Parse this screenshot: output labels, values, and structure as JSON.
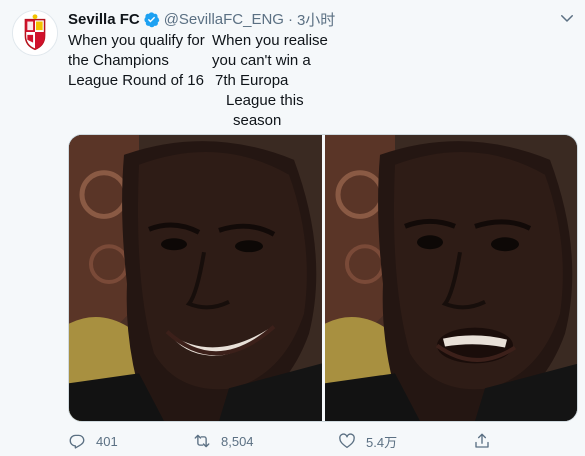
{
  "tweet": {
    "name": "Sevilla FC",
    "handle": "@SevillaFC_ENG",
    "separator": "·",
    "time": "3小时",
    "caption_left": "When you qualify for the Champions League Round of 16",
    "caption_right_lines": [
      "When you realise",
      "you can't win a",
      "7th Europa",
      "  League this",
      "   season"
    ]
  },
  "actions": {
    "reply_count": "401",
    "retweet_count": "8,504",
    "like_count": "5.4万"
  },
  "icons": {
    "avatar": "sevilla-crest",
    "verified": "verified-badge-icon",
    "more": "chevron-down-icon",
    "reply": "reply-icon",
    "retweet": "retweet-icon",
    "like": "heart-icon",
    "share": "share-icon"
  },
  "colors": {
    "accent": "#1da1f2",
    "muted": "#5b7083",
    "background": "#f5f8fa",
    "brand_red": "#d0112b"
  }
}
